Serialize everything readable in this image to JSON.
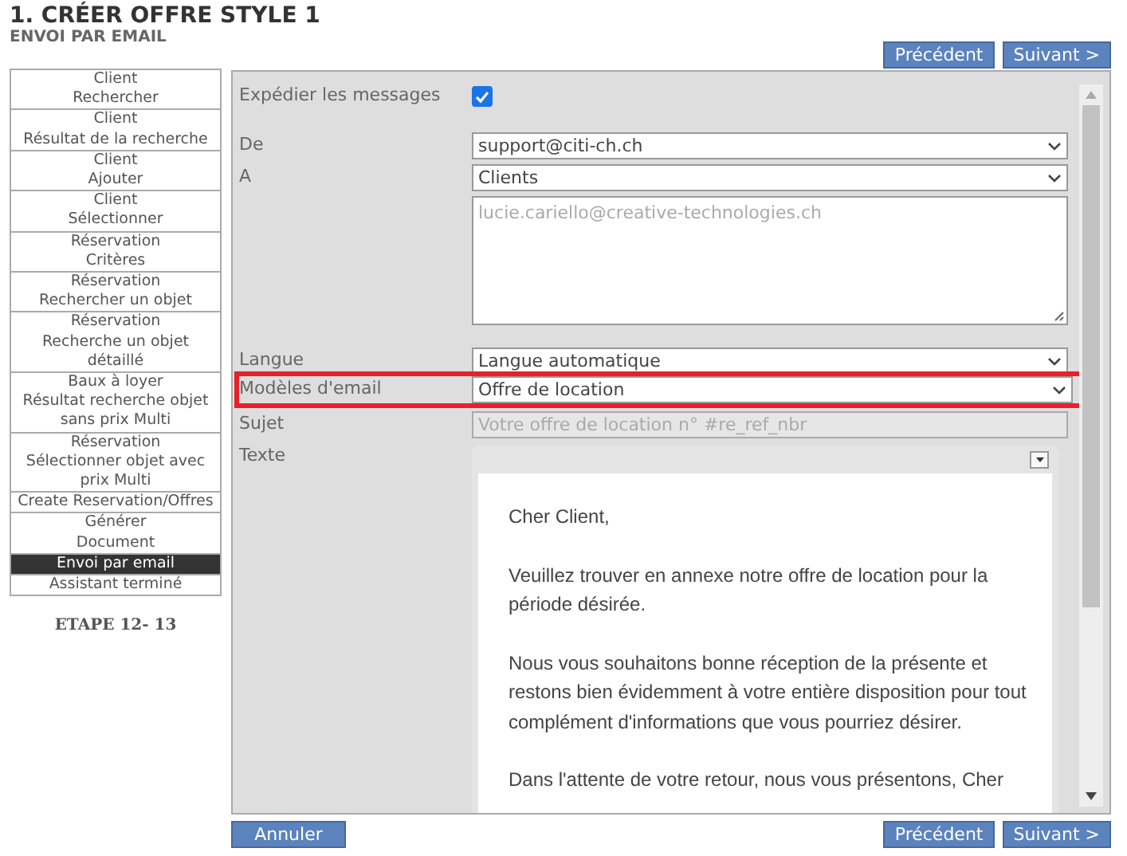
{
  "header": {
    "title": "1. CRÉER OFFRE STYLE 1",
    "subtitle": "ENVOI PAR EMAIL"
  },
  "top_buttons": [
    "Précédent",
    "Suivant >"
  ],
  "steps": [
    {
      "label": "Client\nRechercher",
      "selected": false
    },
    {
      "label": "Client\nRésultat de la recherche",
      "selected": false
    },
    {
      "label": "Client\nAjouter",
      "selected": false
    },
    {
      "label": "Client\nSélectionner",
      "selected": false
    },
    {
      "label": "Réservation\nCritères",
      "selected": false
    },
    {
      "label": "Réservation\nRechercher un objet",
      "selected": false
    },
    {
      "label": "Réservation\nRecherche un objet\ndétaillé",
      "selected": false
    },
    {
      "label": "Baux à loyer\nRésultat recherche objet\nsans prix Multi",
      "selected": false
    },
    {
      "label": "Réservation\nSélectionner objet avec\nprix Multi",
      "selected": false
    },
    {
      "label": "Create Reservation/Offres",
      "selected": false
    },
    {
      "label": "Générer\nDocument",
      "selected": false
    },
    {
      "label": "Envoi par email",
      "selected": true
    },
    {
      "label": "Assistant terminé",
      "selected": false
    }
  ],
  "step_counter": "ETAPE  12- 13",
  "form": [
    {
      "kind": "checkbox",
      "label": "Expédier les messages",
      "checked": true
    },
    {
      "kind": "select",
      "label": "De",
      "value": "support@citi-ch.ch",
      "highlighted": false
    },
    {
      "kind": "select",
      "label": "A",
      "value": "Clients",
      "highlighted": false
    },
    {
      "kind": "textarea",
      "placeholder": "lucie.cariello@creative-technologies.ch"
    },
    {
      "kind": "select",
      "label": "Langue",
      "value": "Langue automatique",
      "highlighted": false
    },
    {
      "kind": "select",
      "label": "Modèles d'email",
      "value": "Offre de location",
      "highlighted": true
    },
    {
      "kind": "input",
      "label": "Sujet",
      "placeholder": "Votre offre de location n° #re_ref_nbr"
    },
    {
      "kind": "editor",
      "label": "Texte",
      "paragraphs": [
        "Cher Client,",
        "Veuillez trouver en annexe notre offre de location pour la période désirée.",
        "Nous vous souhaitons bonne réception de la présente et restons bien évidemment à votre entière disposition pour tout complément d'informations que vous pourriez désirer.",
        "Dans l'attente de votre retour, nous vous présentons, Cher"
      ]
    }
  ],
  "bottom_left_button": "Annuler",
  "bottom_buttons": [
    "Précédent",
    "Suivant >"
  ]
}
